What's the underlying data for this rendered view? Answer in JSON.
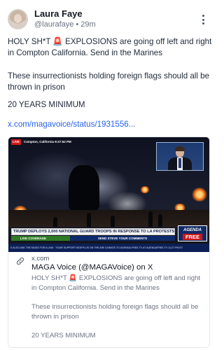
{
  "author": {
    "name": "Laura Faye",
    "handle": "@laurafaye",
    "separator": "•",
    "time": "29m"
  },
  "post": {
    "paragraph1": "HOLY SH*T 🚨 EXPLOSIONS are going off left and right in Compton California. Send in the Marines",
    "paragraph2": "These insurrectionists holding foreign flags should all be thrown in prison",
    "paragraph3": "20 YEARS MINIMUM",
    "link": "x.com/magavoice/status/1931556..."
  },
  "media": {
    "live_badge": "LIVE",
    "location": "Compton, California 9:27:52 PM",
    "headline": "TRUMP DEPLOYS 2,000 NATIONAL GUARD TROOPS IN RESPONSE TO LA PROTESTS",
    "live_coverage": "LIVE COVERAGE",
    "send_comments": "SEND STEVE YOUR COMMENTS",
    "logo_top": "AGENDA",
    "logo_badge": "FREE",
    "ticker": "S ALSO ASK THE MODS FOR A LINK · YOUR SUPPORT KEEPS US ON THE AIR! DONATE TO AGENDA-FREE.TV AT AGENDAFREE.TV  11:27 PM ET"
  },
  "card": {
    "domain": "x.com",
    "title": "MAGA Voice (@MAGAVoice) on X",
    "desc1": "HOLY SH*T 🚨 EXPLOSIONS are going off left and right in Compton California. Send in the Marines",
    "desc2": "These insurrectionists holding foreign flags should all be thrown in prison",
    "desc3": "20 YEARS MINIMUM"
  },
  "icons": {
    "more": "more-vertical-icon",
    "link": "link-icon"
  },
  "colors": {
    "link": "#2563eb",
    "live_red": "#d0181c",
    "live_green": "#2f7a27",
    "news_navy": "#0d2a6b"
  }
}
